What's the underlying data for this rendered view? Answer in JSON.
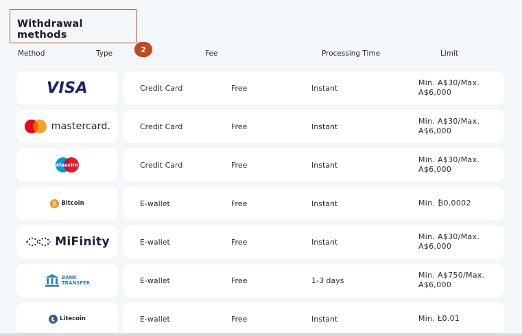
{
  "title": "Withdrawal methods",
  "badge": "2",
  "headers": {
    "method": "Method",
    "type": "Type",
    "fee": "Fee",
    "time": "Processing Time",
    "limit": "Limit"
  },
  "rows": [
    {
      "logo": "visa-logo",
      "logo_text": "VISA",
      "type": "Credit Card",
      "fee": "Free",
      "time": "Instant",
      "limit1": "Min. A$30/Max.",
      "limit2": "A$6,000"
    },
    {
      "logo": "mastercard-logo",
      "logo_text": "mastercard.",
      "type": "Credit Card",
      "fee": "Free",
      "time": "Instant",
      "limit1": "Min. A$30/Max.",
      "limit2": "A$6,000"
    },
    {
      "logo": "maestro-logo",
      "logo_text": "Maestro",
      "type": "Credit Card",
      "fee": "Free",
      "time": "Instant",
      "limit1": "Min. A$30/Max.",
      "limit2": "A$6,000"
    },
    {
      "logo": "bitcoin-logo",
      "logo_text": "Bitcoin",
      "type": "E-wallet",
      "fee": "Free",
      "time": "Instant",
      "limit1": "Min. ₿0.0002",
      "limit2": ""
    },
    {
      "logo": "mifinity-logo",
      "logo_text": "MiFinity",
      "type": "E-wallet",
      "fee": "Free",
      "time": "Instant",
      "limit1": "Min. A$30/Max.",
      "limit2": "A$6,000"
    },
    {
      "logo": "bank-transfer-logo",
      "logo_text1": "BANK",
      "logo_text2": "TRANSFER",
      "type": "E-wallet",
      "fee": "Free",
      "time": "1-3 days",
      "limit1": "Min. A$750/Max.",
      "limit2": "A$6,000"
    },
    {
      "logo": "litecoin-logo",
      "logo_text": "Litecoin",
      "type": "E-wallet",
      "fee": "Free",
      "time": "Instant",
      "limit1": "Min. Ł0.01",
      "limit2": ""
    }
  ],
  "colors": {
    "accent": "#c2481e",
    "visa": "#1a1f71",
    "mc_red": "#eb001b",
    "mc_orange": "#f79e1b",
    "bitcoin": "#f7931a",
    "litecoin": "#345d9d",
    "bank": "#2a7fc2"
  }
}
